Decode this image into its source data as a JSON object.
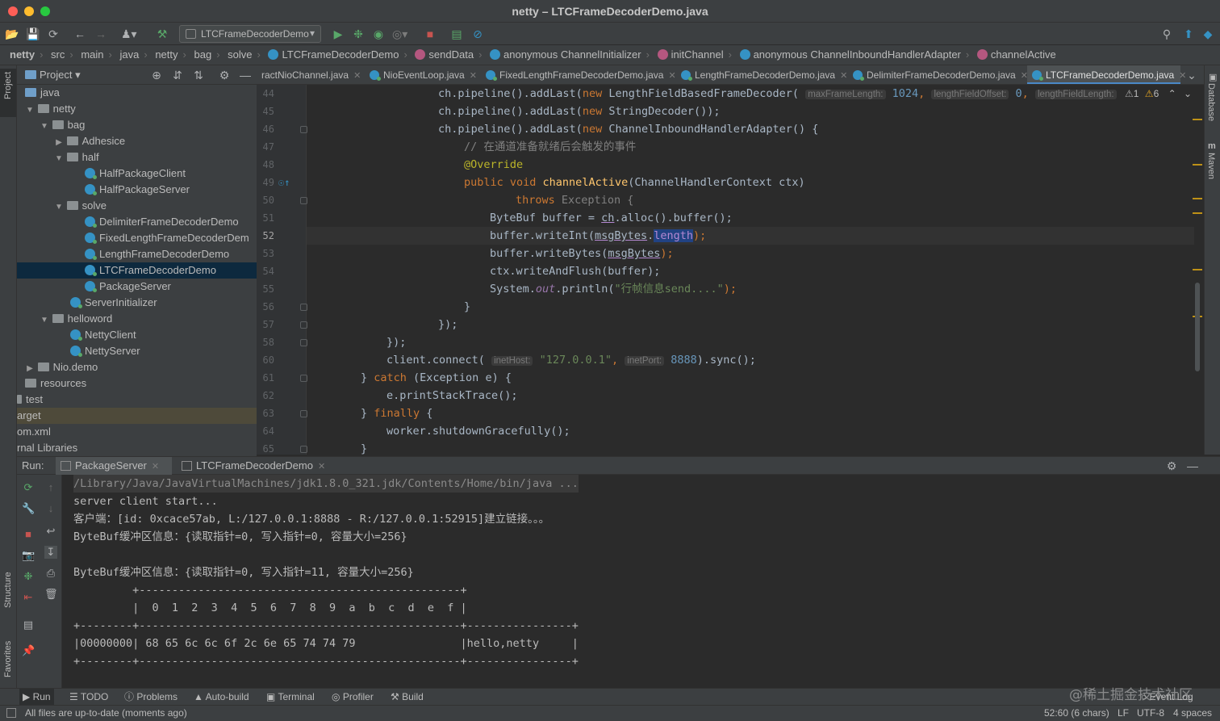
{
  "window": {
    "title": "netty – LTCFrameDecoderDemo.java",
    "traffic_colors": [
      "#fe5f57",
      "#febc2e",
      "#28c840"
    ]
  },
  "toolbar": {
    "run_config": "LTCFrameDecoderDemo"
  },
  "breadcrumb": [
    "netty",
    "src",
    "main",
    "java",
    "netty",
    "bag",
    "solve",
    "LTCFrameDecoderDemo",
    "sendData",
    "anonymous ChannelInitializer",
    "initChannel",
    "anonymous ChannelInboundHandlerAdapter",
    "channelActive"
  ],
  "left_stripe": {
    "project": "Project",
    "structure": "Structure",
    "favorites": "Favorites"
  },
  "right_stripe": {
    "database": "Database",
    "maven": "Maven"
  },
  "project": {
    "title": "Project",
    "tree": [
      {
        "label": "java",
        "icon": "folder-blue"
      },
      {
        "label": "netty",
        "icon": "folder"
      },
      {
        "label": "bag",
        "icon": "folder"
      },
      {
        "label": "Adhesice",
        "icon": "folder"
      },
      {
        "label": "half",
        "icon": "folder"
      },
      {
        "label": "HalfPackageClient",
        "icon": "class"
      },
      {
        "label": "HalfPackageServer",
        "icon": "class"
      },
      {
        "label": "solve",
        "icon": "folder"
      },
      {
        "label": "DelimiterFrameDecoderDemo",
        "icon": "class"
      },
      {
        "label": "FixedLengthFrameDecoderDem",
        "icon": "class"
      },
      {
        "label": "LengthFrameDecoderDemo",
        "icon": "class"
      },
      {
        "label": "LTCFrameDecoderDemo",
        "icon": "class"
      },
      {
        "label": "PackageServer",
        "icon": "class"
      },
      {
        "label": "ServerInitializer",
        "icon": "class"
      },
      {
        "label": "helloword",
        "icon": "folder"
      },
      {
        "label": "NettyClient",
        "icon": "class"
      },
      {
        "label": "NettyServer",
        "icon": "class"
      },
      {
        "label": "Nio.demo",
        "icon": "folder"
      },
      {
        "label": "resources",
        "icon": "folder"
      },
      {
        "label": "test",
        "icon": "folder"
      },
      {
        "label": "arget",
        "icon": "none"
      },
      {
        "label": "om.xml",
        "icon": "none"
      },
      {
        "label": "rnal Libraries",
        "icon": "none"
      }
    ]
  },
  "editor_tabs": [
    {
      "label": "ractNioChannel.java"
    },
    {
      "label": "NioEventLoop.java"
    },
    {
      "label": "FixedLengthFrameDecoderDemo.java"
    },
    {
      "label": "LengthFrameDecoderDemo.java"
    },
    {
      "label": "DelimiterFrameDecoderDemo.java"
    },
    {
      "label": "LTCFrameDecoderDemo.java"
    }
  ],
  "inspections": {
    "warnings": "1",
    "weak_warnings": "6"
  },
  "code": {
    "line_numbers": [
      "44",
      "45",
      "46",
      "47",
      "48",
      "49",
      "50",
      "51",
      "52",
      "53",
      "54",
      "55",
      "56",
      "57",
      "58",
      "60",
      "61",
      "62",
      "63",
      "64",
      "65"
    ],
    "l44": [
      "ch.pipeline().addLast(",
      "new",
      " LengthFieldBasedFrameDecoder(",
      "maxFrameLength:",
      "1024",
      ",",
      "lengthFieldOffset:",
      "0",
      ",",
      "lengthFieldLength:"
    ],
    "l45": [
      "ch.pipeline().addLast(",
      "new",
      " StringDecoder());"
    ],
    "l46": [
      "ch.pipeline().addLast(",
      "new",
      " ChannelInboundHandlerAdapter() {"
    ],
    "l47": "// 在通道准备就绪后会触发的事件",
    "l48": "@Override",
    "l49": [
      "public void",
      "channelActive",
      "(ChannelHandlerContext ctx)"
    ],
    "l50": [
      "throws",
      "Exception {"
    ],
    "l51": [
      "ByteBuf buffer = ",
      "ch",
      ".alloc().buffer();"
    ],
    "l52": [
      "buffer.writeInt(",
      "msgBytes",
      ".",
      "length",
      ");"
    ],
    "l53": [
      "buffer.writeBytes(",
      "msgBytes",
      ");"
    ],
    "l54": "ctx.writeAndFlush(buffer);",
    "l55": [
      "System.",
      "out",
      ".println(",
      "\"行帧信息send....\"",
      ");"
    ],
    "l56": "}",
    "l57": "});",
    "l58": "});",
    "l60": [
      "client.connect(",
      "inetHost:",
      "\"127.0.0.1\"",
      ",",
      "inetPort:",
      "8888",
      ").sync();"
    ],
    "l61": [
      "} ",
      "catch",
      " (Exception e) {"
    ],
    "l62": "e.printStackTrace();",
    "l63": [
      "} ",
      "finally",
      " {"
    ],
    "l64": "worker.shutdownGracefully();",
    "l65": "}"
  },
  "run": {
    "label": "Run:",
    "tabs": [
      "PackageServer",
      "LTCFrameDecoderDemo"
    ],
    "console": [
      "/Library/Java/JavaVirtualMachines/jdk1.8.0_321.jdk/Contents/Home/bin/java ...",
      "server client start...",
      "客户端：[id: 0xcace57ab, L:/127.0.0.1:8888 - R:/127.0.0.1:52915]建立链接。。。",
      "ByteBuf缓冲区信息：{读取指针=0, 写入指针=0, 容量大小=256}",
      "",
      "ByteBuf缓冲区信息：{读取指针=0, 写入指针=11, 容量大小=256}",
      "         +-------------------------------------------------+",
      "         |  0  1  2  3  4  5  6  7  8  9  a  b  c  d  e  f |",
      "+--------+-------------------------------------------------+----------------+",
      "|00000000| 68 65 6c 6c 6f 2c 6e 65 74 74 79                |hello,netty     |",
      "+--------+-------------------------------------------------+----------------+"
    ]
  },
  "bottom_tools": [
    "Run",
    "TODO",
    "Problems",
    "Auto-build",
    "Terminal",
    "Profiler",
    "Build"
  ],
  "event_log": "Event Log",
  "status": {
    "message": "All files are up-to-date (moments ago)",
    "position": "52:60 (6 chars)",
    "line_sep": "LF",
    "encoding": "UTF-8",
    "indent": "4 spaces"
  },
  "watermark": "@稀土掘金技术社区"
}
